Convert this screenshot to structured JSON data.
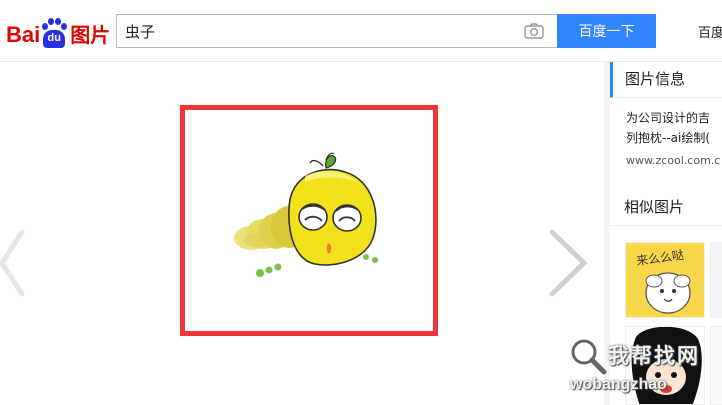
{
  "header": {
    "logo_text_bai": "Bai",
    "logo_text_du": "du",
    "logo_text_tupian": "图片",
    "search_value": "虫子",
    "search_button_label": "百度一下",
    "top_link_label": "百度"
  },
  "panel_info": {
    "title": "图片信息",
    "desc_line1": "为公司设计的吉",
    "desc_line2": "列抱枕--ai绘制(",
    "url": "www.zcool.com.c"
  },
  "panel_similar": {
    "title": "相似图片",
    "thumb1_text": "来么么哒"
  },
  "watermark": {
    "line1": "我帮找网",
    "line2": "wobangzhao"
  },
  "colors": {
    "brand_red": "#e10601",
    "brand_blue": "#2932e1",
    "accent_blue": "#3385ff",
    "frame_red": "#f0353a"
  }
}
